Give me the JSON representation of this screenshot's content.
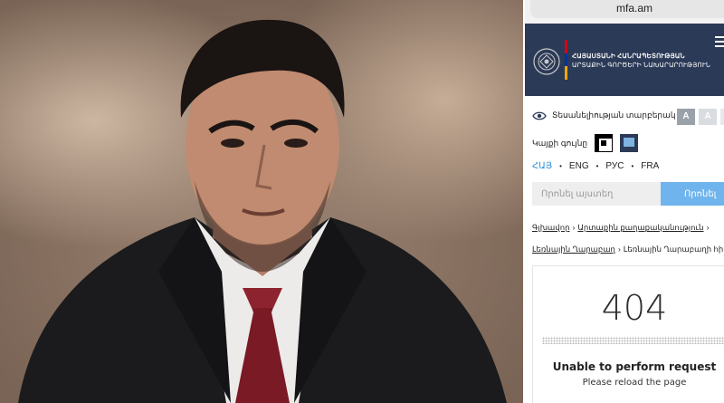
{
  "browser": {
    "url": "mfa.am"
  },
  "header": {
    "ministry_line1": "ՀԱՅԱՍՏԱՆԻ ՀԱՆՐԱՊԵՏՈՒԹՅԱՆ",
    "ministry_line2": "ԱՐՏԱՔԻՆ ԳՈՐԾԵՐԻ ՆԱԽԱՐԱՐՈՒԹՅՈՒՆ",
    "menu_icon": "hamburger-menu-icon"
  },
  "accessibility": {
    "vision_label": "Տեսանելիության տարբերակ",
    "font_sizes": [
      "A",
      "A",
      "A"
    ],
    "colors_label": "Կայքի գույնը"
  },
  "languages": {
    "items": [
      "ՀԱՅ",
      "ENG",
      "РУС",
      "FRA"
    ],
    "active": "ՀԱՅ",
    "active_color": "#2e8fd6"
  },
  "search": {
    "placeholder": "Որոնել այստեղ",
    "button_label": "Որոնել"
  },
  "breadcrumb": {
    "items": [
      "Գլխավոր",
      "Արտաքին քաղաքականություն",
      "Լեռնային Ղարաբաղ",
      "Լեռնային Ղարաբաղի հիմնախնդիր"
    ]
  },
  "error": {
    "code": "404",
    "title": "Unable to perform request",
    "subtitle": "Please reload the page"
  },
  "colors": {
    "header_bg": "#2b3a57",
    "search_button": "#6fb4ec"
  }
}
